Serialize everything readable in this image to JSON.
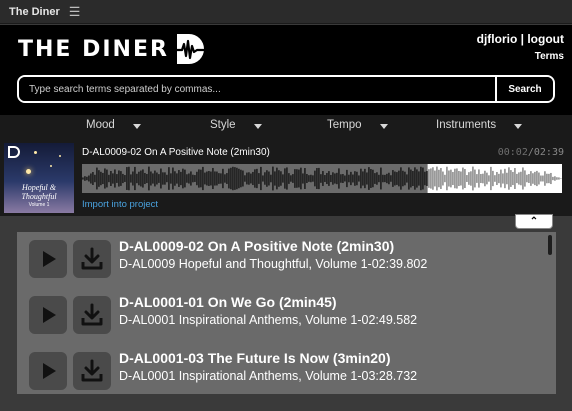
{
  "window": {
    "title": "The Diner",
    "menu_icon": "hamburger-icon"
  },
  "header": {
    "logo_text": "THE DINER",
    "user": "djflorio",
    "separator": "|",
    "logout": "logout",
    "terms": "Terms"
  },
  "search": {
    "placeholder": "Type search terms separated by commas...",
    "value": "",
    "button": "Search"
  },
  "filters": [
    "Mood",
    "Style",
    "Tempo",
    "Instruments"
  ],
  "player": {
    "track": "D-AL0009-02 On A Positive Note (2min30)",
    "time_current": "00:02",
    "time_sep": "/",
    "time_total": "02:39",
    "import_label": "Import into project",
    "progress": 0.72,
    "cover": {
      "title": "Hopeful & Thoughtful",
      "subtitle": "Volume 1"
    }
  },
  "collapse_icon": "chevron-up-icon",
  "results": [
    {
      "title": "D-AL0009-02 On A Positive Note (2min30)",
      "subtitle": "D-AL0009 Hopeful and Thoughtful, Volume 1-02:39.802"
    },
    {
      "title": "D-AL0001-01 On We Go (2min45)",
      "subtitle": "D-AL0001 Inspirational Anthems, Volume 1-02:49.582"
    },
    {
      "title": "D-AL0001-03 The Future Is Now (3min20)",
      "subtitle": "D-AL0001 Inspirational Anthems, Volume 1-03:28.732"
    }
  ],
  "colors": {
    "header_bg": "#000000",
    "link": "#4aa3e0",
    "panel_bg": "#6a6a6a",
    "button_bg": "#4a4a4a"
  }
}
